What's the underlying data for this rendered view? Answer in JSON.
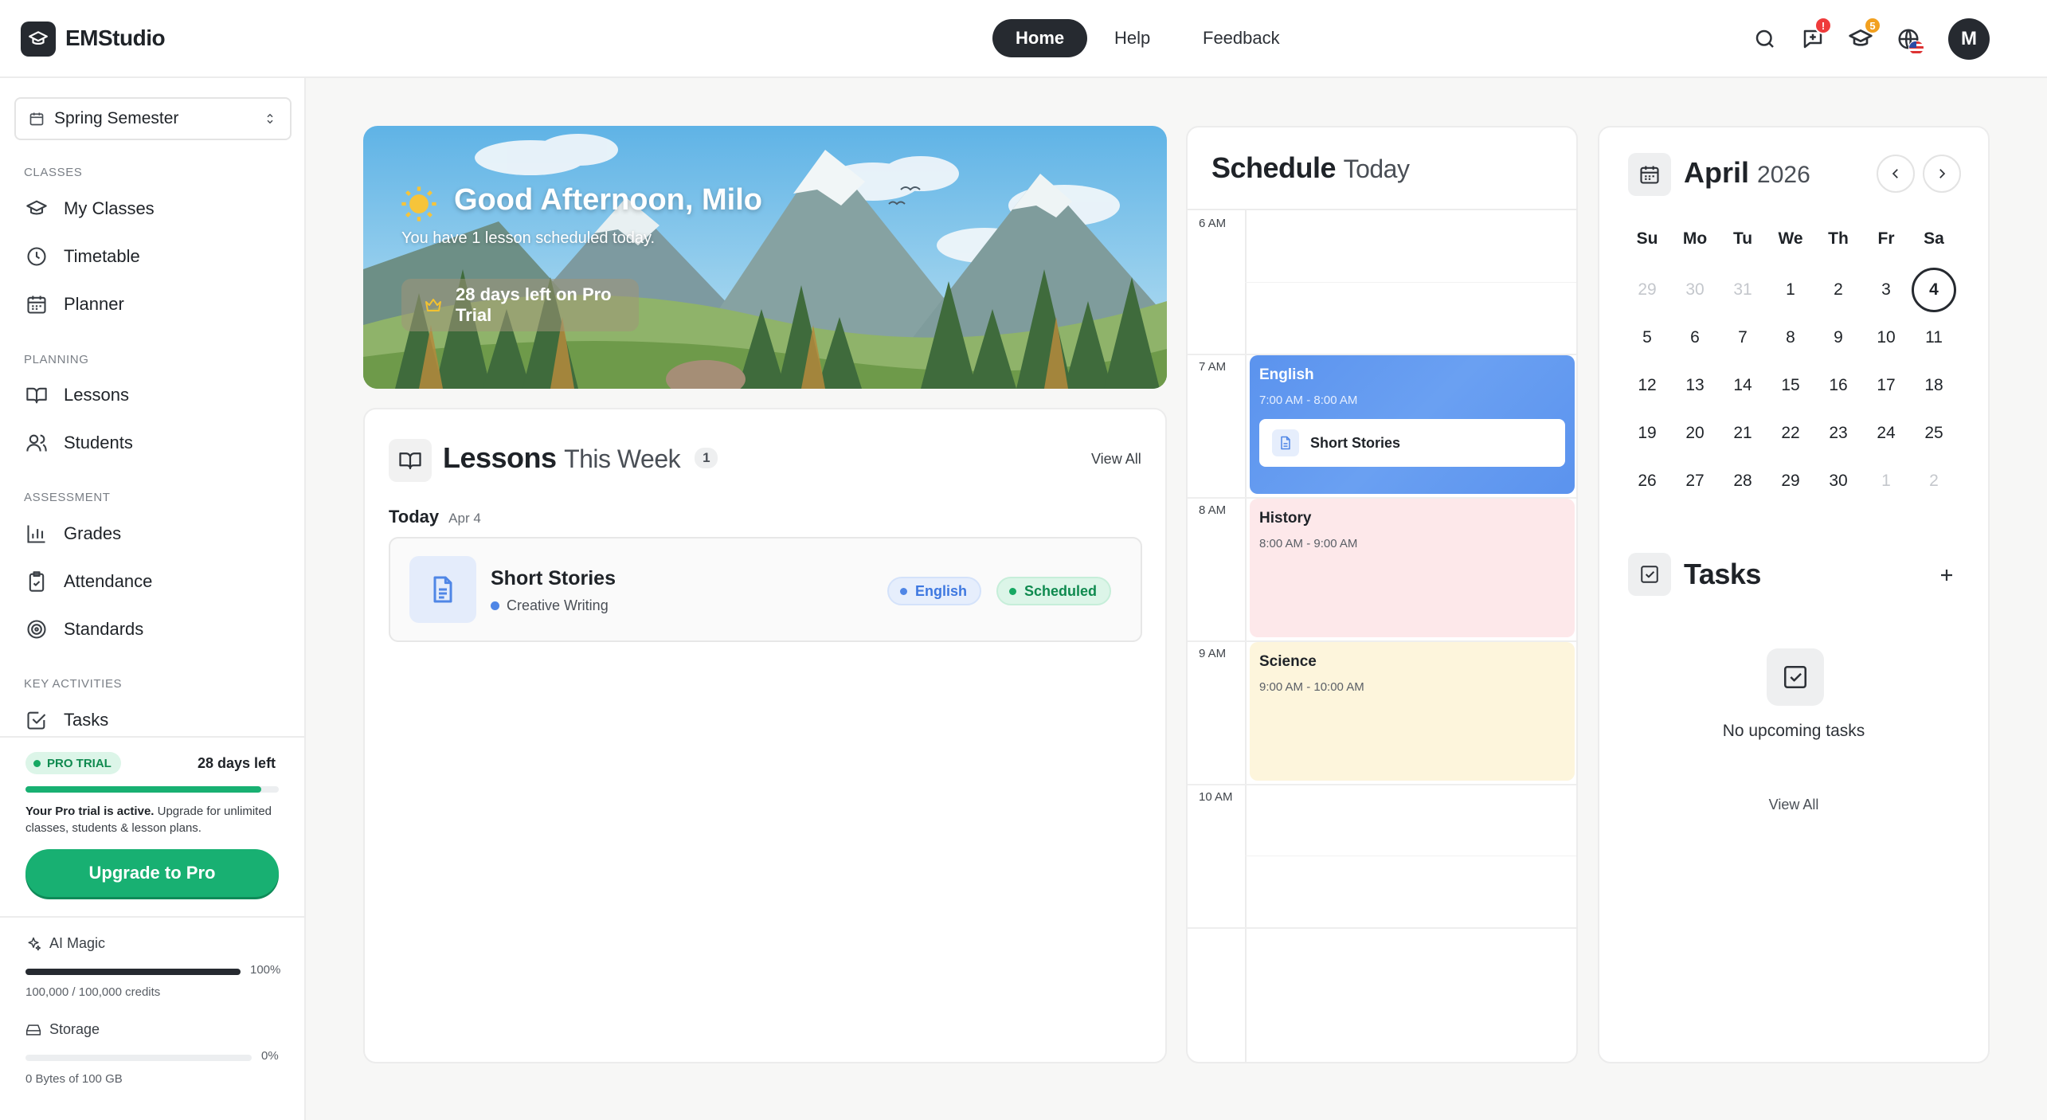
{
  "app": {
    "name": "EMStudio"
  },
  "nav": {
    "home": "Home",
    "help": "Help",
    "feedback": "Feedback"
  },
  "header": {
    "notifications_badge": "!",
    "classes_badge": "5",
    "avatar_initial": "M"
  },
  "sidebar": {
    "semester": "Spring Semester",
    "sections": {
      "classes": "CLASSES",
      "planning": "PLANNING",
      "assessment": "ASSESSMENT",
      "key_activities": "KEY ACTIVITIES"
    },
    "items": {
      "my_classes": "My Classes",
      "timetable": "Timetable",
      "planner": "Planner",
      "lessons": "Lessons",
      "students": "Students",
      "grades": "Grades",
      "attendance": "Attendance",
      "standards": "Standards",
      "tasks": "Tasks"
    },
    "trial": {
      "badge": "PRO TRIAL",
      "days_left": "28 days left",
      "progress": 0.93,
      "message_bold": "Your Pro trial is active.",
      "message_rest": " Upgrade for unlimited classes, students & lesson plans.",
      "upgrade_button": "Upgrade to Pro"
    },
    "ai_magic": {
      "label": "AI Magic",
      "percent": "100%",
      "progress": 1.0,
      "credits": "100,000 / 100,000 credits"
    },
    "storage": {
      "label": "Storage",
      "percent": "0%",
      "progress": 0.0,
      "usage": "0 Bytes of 100 GB"
    }
  },
  "hero": {
    "greeting": "Good Afternoon, Milo",
    "subtitle": "You have 1 lesson scheduled today.",
    "trial_pill": "28 days left on Pro Trial"
  },
  "lessons_card": {
    "title": "Lessons",
    "title_light": "This Week",
    "count": "1",
    "view_all": "View All",
    "day_label": "Today",
    "day_date": "Apr 4",
    "lesson": {
      "title": "Short Stories",
      "subtitle": "Creative Writing",
      "subject_tag": "English",
      "status_tag": "Scheduled"
    }
  },
  "schedule": {
    "title": "Schedule",
    "title_light": "Today",
    "hours": [
      "6 AM",
      "7 AM",
      "8 AM",
      "9 AM",
      "10 AM"
    ],
    "events": [
      {
        "name": "English",
        "time": "7:00 AM - 8:00 AM",
        "lesson": "Short Stories"
      },
      {
        "name": "History",
        "time": "8:00 AM - 9:00 AM"
      },
      {
        "name": "Science",
        "time": "9:00 AM - 10:00 AM"
      }
    ]
  },
  "calendar": {
    "month": "April",
    "year": "2026",
    "weekdays": [
      "Su",
      "Mo",
      "Tu",
      "We",
      "Th",
      "Fr",
      "Sa"
    ],
    "weeks": [
      [
        "29",
        "30",
        "31",
        "1",
        "2",
        "3",
        "4"
      ],
      [
        "5",
        "6",
        "7",
        "8",
        "9",
        "10",
        "11"
      ],
      [
        "12",
        "13",
        "14",
        "15",
        "16",
        "17",
        "18"
      ],
      [
        "19",
        "20",
        "21",
        "22",
        "23",
        "24",
        "25"
      ],
      [
        "26",
        "27",
        "28",
        "29",
        "30",
        "1",
        "2"
      ]
    ],
    "today": "4"
  },
  "tasks_card": {
    "title": "Tasks",
    "empty_text": "No upcoming tasks",
    "view_all": "View All"
  },
  "colors": {
    "accent_dark": "#262a30",
    "upgrade_green": "#18b072",
    "english_blue": "#5b93ee",
    "history_pink": "#fde8ea",
    "science_yellow": "#fdf5dc"
  }
}
